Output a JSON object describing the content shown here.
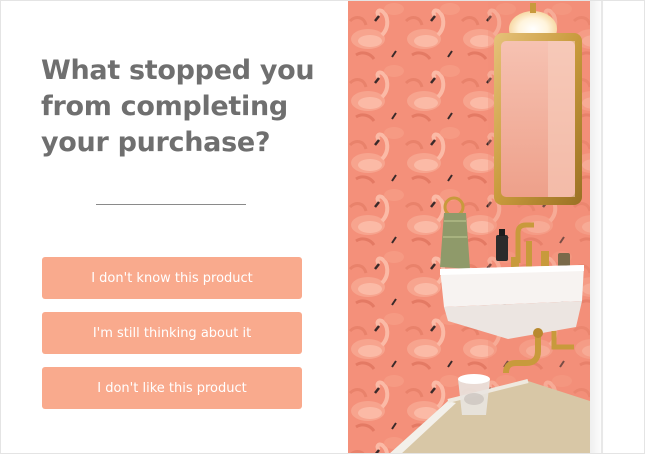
{
  "survey": {
    "question": "What stopped you from completing your purchase?",
    "options": [
      "I don't know this product",
      "I'm still thinking about it",
      "I don't like this product"
    ]
  },
  "image": {
    "subject": "pink flamingo wallpaper bathroom with gold mirror and sink",
    "colors": {
      "wallpaper": "#f4907a",
      "mirror_frame": "#c89a3c",
      "sink": "#f7f3f1",
      "floor": "#d8c7a6"
    }
  },
  "colors": {
    "heading": "#6f6f6f",
    "button_bg": "#f9aa8d",
    "button_text": "#ffffff",
    "divider": "#8a8a8a"
  }
}
